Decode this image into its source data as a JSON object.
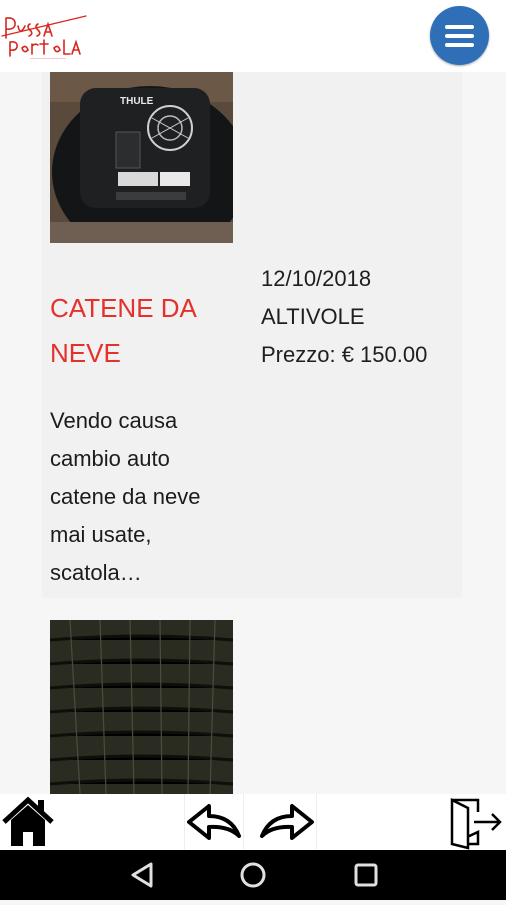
{
  "header": {
    "logo_alt": "Fuori Portola",
    "menu_icon": "hamburger-menu-icon"
  },
  "listings": [
    {
      "title": "CATENE DA NEVE",
      "description": "Vendo causa cambio auto catene da neve mai usate, scatola…",
      "date": "12/10/2018",
      "location": "ALTIVOLE",
      "price": "Prezzo: € 150.00",
      "image": "snow-chains-box-image"
    },
    {
      "image": "tire-tread-image"
    }
  ],
  "bottom_nav": {
    "home_icon": "home-icon",
    "back_icon": "back-arrow-icon",
    "forward_icon": "forward-arrow-icon",
    "exit_icon": "exit-door-icon"
  },
  "system_nav": {
    "back": "triangle-back-icon",
    "home": "circle-home-icon",
    "recents": "square-recents-icon"
  },
  "colors": {
    "title_red": "#e4312b",
    "menu_blue": "#2f6fb8",
    "background": "#f6f6f6",
    "card": "#f1f1f1"
  }
}
